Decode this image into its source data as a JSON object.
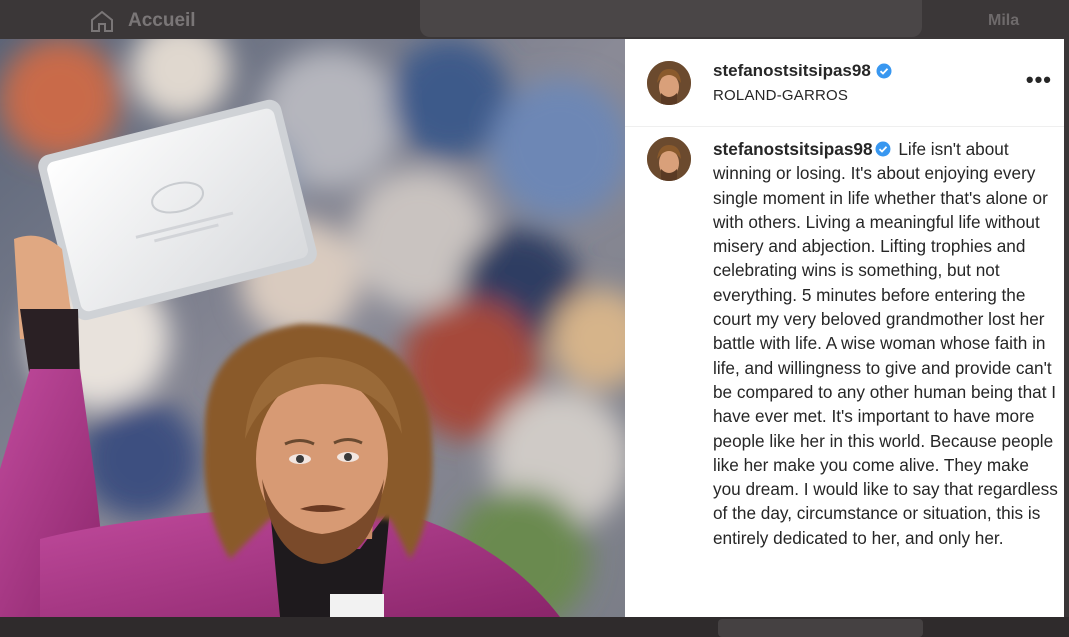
{
  "background": {
    "home_label": "Accueil",
    "top_right_label": "Mila"
  },
  "post": {
    "username": "stefanostsitsipas98",
    "location": "ROLAND-GARROS",
    "caption": "Life isn't about winning or losing. It's about enjoying every single moment in life whether that's alone or with others. Living a meaningful life without misery and abjection. Lifting trophies and celebrating wins is something, but not everything. 5 minutes before entering the court my very beloved grandmother lost her battle with life. A wise woman whose faith in life, and willingness to give and provide can't be compared to any other human being that I have ever met. It's important to have more people like her in this world. Because people like her make you come alive. They make you dream. I would like to say that regardless of the day, circumstance or situation, this is entirely dedicated to her, and only her."
  },
  "icons": {
    "home": "home-icon",
    "verified": "verified-badge-icon",
    "more": "more-options-icon",
    "avatar": "avatar"
  },
  "colors": {
    "verified_blue": "#3897f0",
    "text": "#262626",
    "jacket": "#a0307e"
  }
}
